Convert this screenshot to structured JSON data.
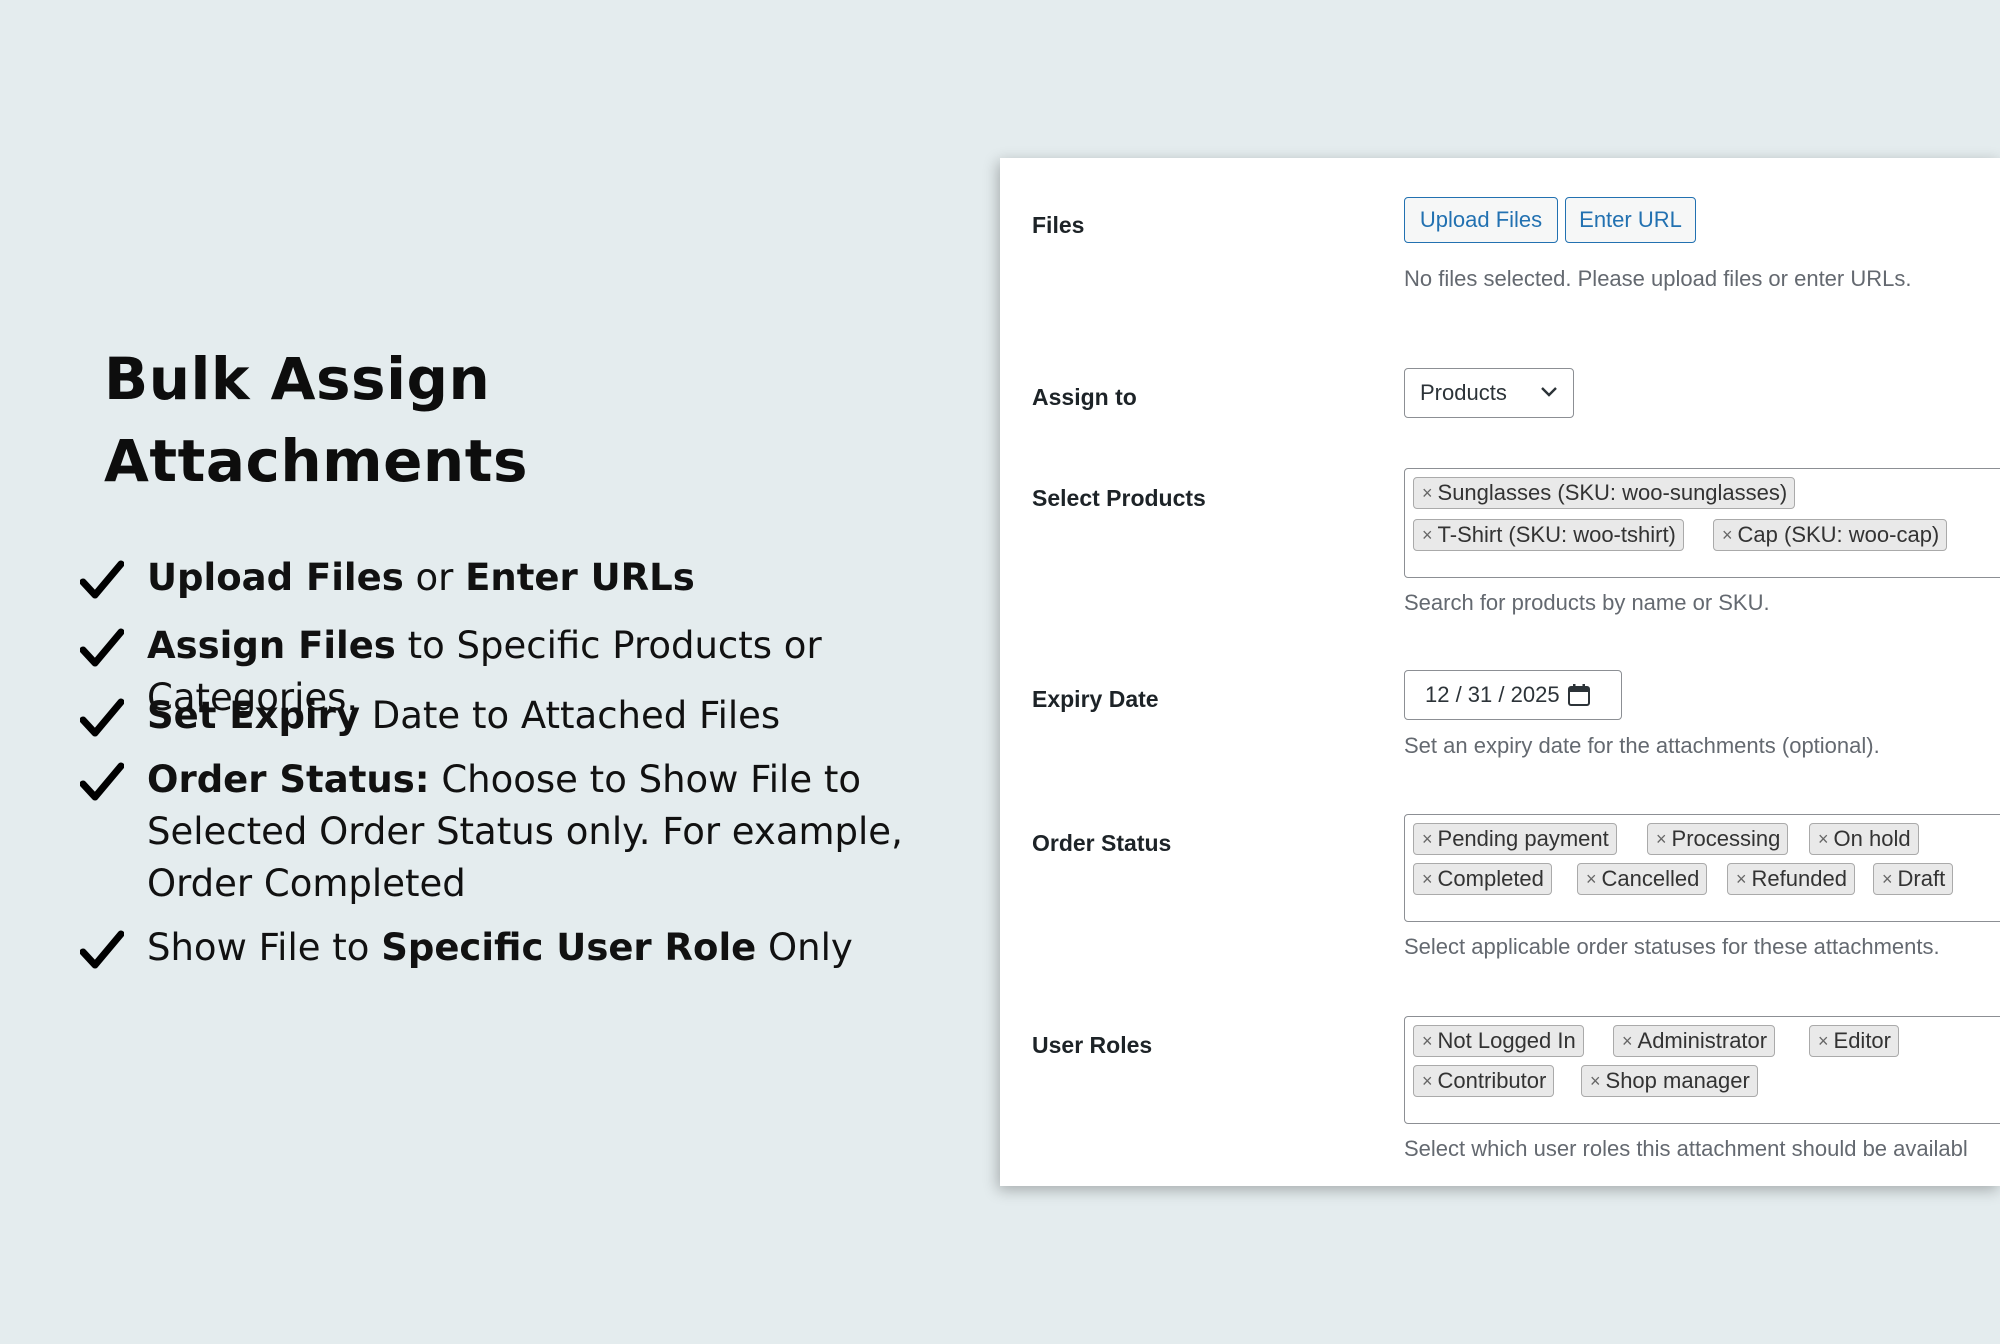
{
  "headline": {
    "line1": "Bulk Assign",
    "line2": "Attachments"
  },
  "features": [
    {
      "parts": [
        {
          "t": "Upload Files",
          "b": true
        },
        {
          "t": " or ",
          "b": false
        },
        {
          "t": "Enter URLs",
          "b": true
        }
      ]
    },
    {
      "parts": [
        {
          "t": "Assign Files",
          "b": true
        },
        {
          "t": " to Specific Products or Categories.",
          "b": false
        }
      ]
    },
    {
      "parts": [
        {
          "t": "Set Expiry",
          "b": true
        },
        {
          "t": " Date to Attached Files",
          "b": false
        }
      ]
    },
    {
      "parts": [
        {
          "t": "Order Status:",
          "b": true
        },
        {
          "t": " Choose to Show File to Selected Order Status only. For example, Order Completed",
          "b": false
        }
      ]
    },
    {
      "parts": [
        {
          "t": "Show File to ",
          "b": false
        },
        {
          "t": "Specific User Role",
          "b": true
        },
        {
          "t": " Only",
          "b": false
        }
      ]
    }
  ],
  "form": {
    "files": {
      "label": "Files",
      "upload_button": "Upload Files",
      "url_button": "Enter URL",
      "hint": "No files selected. Please upload files or enter URLs."
    },
    "assign": {
      "label": "Assign to",
      "value": "Products"
    },
    "products": {
      "label": "Select Products",
      "chips": [
        "Sunglasses (SKU: woo-sunglasses)",
        "T-Shirt (SKU: woo-tshirt)",
        "Cap (SKU: woo-cap)"
      ],
      "hint": "Search for products by name or SKU."
    },
    "expiry": {
      "label": "Expiry Date",
      "value": "12 / 31 / 2025",
      "hint": "Set an expiry date for the attachments (optional)."
    },
    "order_status": {
      "label": "Order Status",
      "chips": [
        "Pending payment",
        "Processing",
        "On hold",
        "Completed",
        "Cancelled",
        "Refunded",
        "Draft"
      ],
      "hint": "Select applicable order statuses for these attachments."
    },
    "user_roles": {
      "label": "User Roles",
      "chips": [
        "Not Logged In",
        "Administrator",
        "Editor",
        "Contributor",
        "Shop manager"
      ],
      "hint": "Select which user roles this attachment should be availabl"
    },
    "remove_symbol": "×"
  },
  "colors": {
    "accent": "#2271b1",
    "background": "#e4ecee",
    "hint": "#646970"
  }
}
